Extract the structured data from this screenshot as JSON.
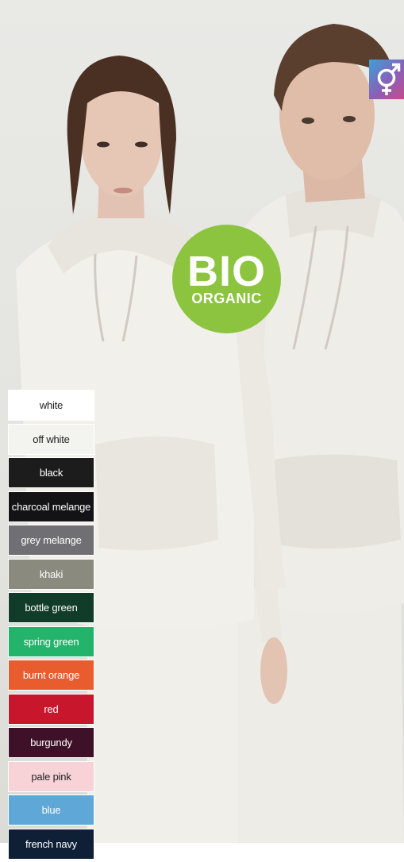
{
  "badge": {
    "line1": "BIO",
    "line2": "ORGANIC",
    "color": "#8cc43f"
  },
  "gender_icon": {
    "icon": "unisex-symbol-icon",
    "colors": [
      "#3aa2d8",
      "#8a5fb8",
      "#c64b8c"
    ]
  },
  "swatches": [
    {
      "label": "white",
      "bg": "#ffffff",
      "fg": "#222222"
    },
    {
      "label": "off white",
      "bg": "#f3f3f0",
      "fg": "#222222"
    },
    {
      "label": "black",
      "bg": "#1c1c1c",
      "fg": "#ffffff"
    },
    {
      "label": "charcoal melange",
      "bg": "#131316",
      "fg": "#ffffff"
    },
    {
      "label": "grey melange",
      "bg": "#6f6f74",
      "fg": "#ffffff"
    },
    {
      "label": "khaki",
      "bg": "#8b8a7f",
      "fg": "#ffffff"
    },
    {
      "label": "bottle green",
      "bg": "#123c2a",
      "fg": "#ffffff"
    },
    {
      "label": "spring green",
      "bg": "#23b36a",
      "fg": "#ffffff"
    },
    {
      "label": "burnt orange",
      "bg": "#e85c2e",
      "fg": "#ffffff"
    },
    {
      "label": "red",
      "bg": "#c8162d",
      "fg": "#ffffff"
    },
    {
      "label": "burgundy",
      "bg": "#3e1128",
      "fg": "#ffffff"
    },
    {
      "label": "pale pink",
      "bg": "#f7d3d8",
      "fg": "#222222"
    },
    {
      "label": "blue",
      "bg": "#5fa7d6",
      "fg": "#ffffff"
    },
    {
      "label": "french navy",
      "bg": "#0f2036",
      "fg": "#ffffff"
    }
  ]
}
